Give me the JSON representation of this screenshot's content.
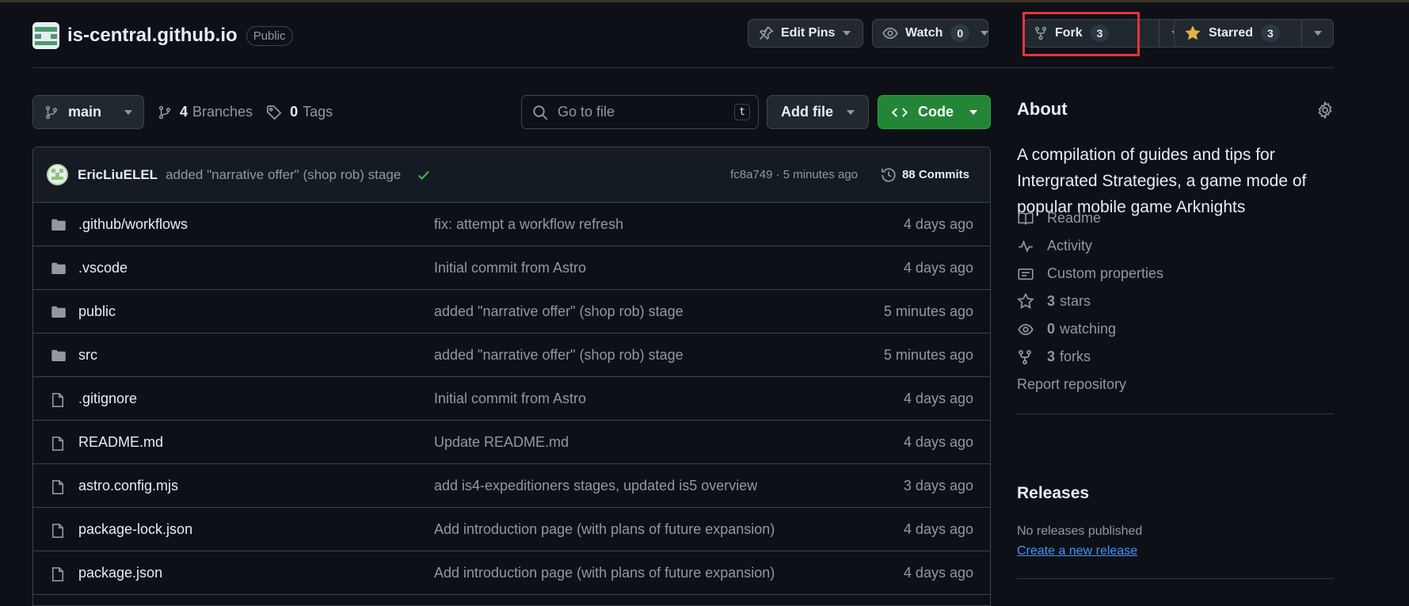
{
  "repo": {
    "name": "is-central.github.io",
    "visibility": "Public"
  },
  "actions": {
    "edit_pins": "Edit Pins",
    "watch": "Watch",
    "watch_count": "0",
    "fork": "Fork",
    "fork_count": "3",
    "starred": "Starred",
    "star_count": "3"
  },
  "branch": {
    "current": "main",
    "branches_count": "4",
    "branches_label": "Branches",
    "tags_count": "0",
    "tags_label": "Tags"
  },
  "search": {
    "placeholder": "Go to file",
    "shortcut": "t"
  },
  "buttons": {
    "add_file": "Add file",
    "code": "Code"
  },
  "latest_commit": {
    "author": "EricLiuELEL",
    "message": "added \"narrative offer\" (shop rob) stage",
    "sha_time": "fc8a749 · 5 minutes ago",
    "commits_count": "88 Commits"
  },
  "files": [
    {
      "type": "folder",
      "name": ".github/workflows",
      "message": "fix: attempt a workflow refresh",
      "age": "4 days ago"
    },
    {
      "type": "folder",
      "name": ".vscode",
      "message": "Initial commit from Astro",
      "age": "4 days ago"
    },
    {
      "type": "folder",
      "name": "public",
      "message": "added \"narrative offer\" (shop rob) stage",
      "age": "5 minutes ago"
    },
    {
      "type": "folder",
      "name": "src",
      "message": "added \"narrative offer\" (shop rob) stage",
      "age": "5 minutes ago"
    },
    {
      "type": "file",
      "name": ".gitignore",
      "message": "Initial commit from Astro",
      "age": "4 days ago"
    },
    {
      "type": "file",
      "name": "README.md",
      "message": "Update README.md",
      "age": "4 days ago"
    },
    {
      "type": "file",
      "name": "astro.config.mjs",
      "message": "add is4-expeditioners stages, updated is5 overview",
      "age": "3 days ago"
    },
    {
      "type": "file",
      "name": "package-lock.json",
      "message": "Add introduction page (with plans of future expansion)",
      "age": "4 days ago"
    },
    {
      "type": "file",
      "name": "package.json",
      "message": "Add introduction page (with plans of future expansion)",
      "age": "4 days ago"
    }
  ],
  "about": {
    "title": "About",
    "description": "A compilation of guides and tips for Intergrated Strategies, a game mode of popular mobile game Arknights",
    "readme": "Readme",
    "activity": "Activity",
    "custom_properties": "Custom properties",
    "stars_count": "3",
    "stars_label": "stars",
    "watching_count": "0",
    "watching_label": "watching",
    "forks_count": "3",
    "forks_label": "forks",
    "report": "Report repository"
  },
  "releases": {
    "title": "Releases",
    "none": "No releases published",
    "create": "Create a new release"
  },
  "colors": {
    "background": "#0d1117",
    "accent_green": "#238636",
    "link_blue": "#4493f8",
    "star_gold": "#e3b341",
    "highlight_red": "#e5343a"
  }
}
